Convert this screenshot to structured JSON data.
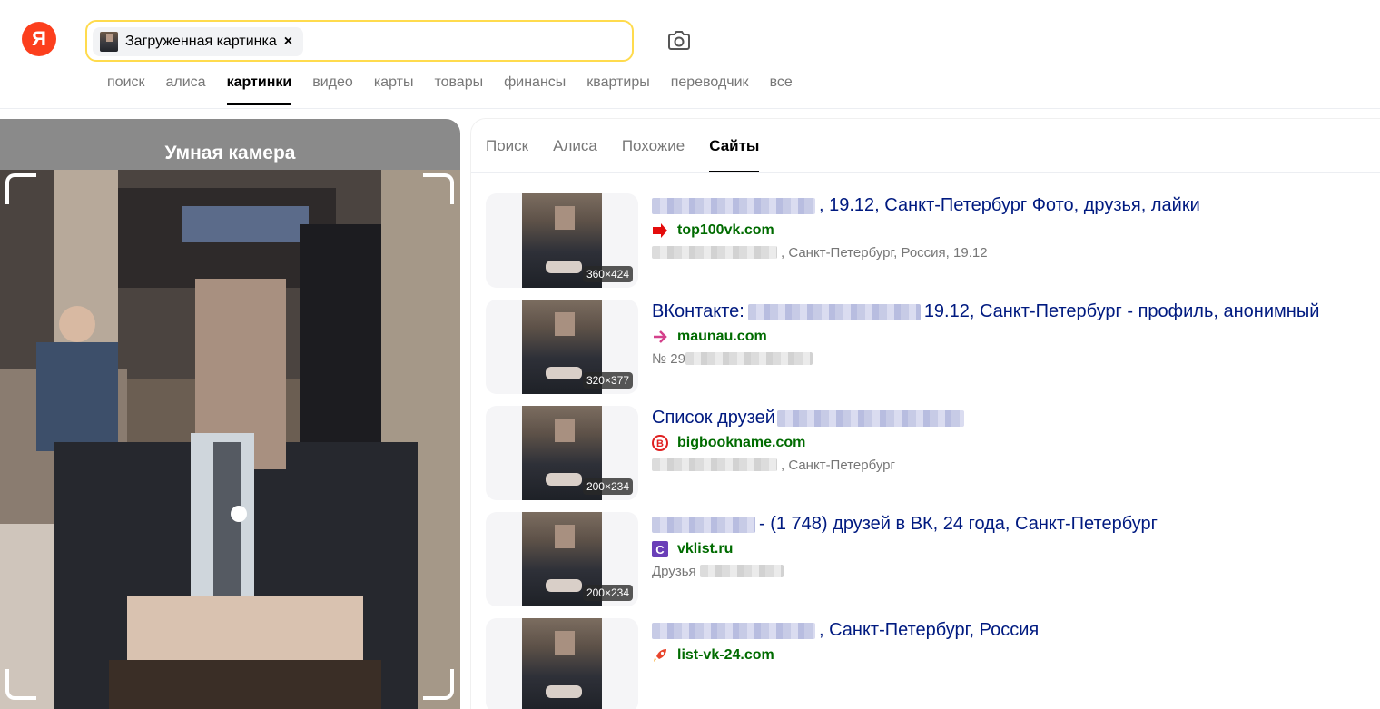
{
  "header": {
    "logo": "Я",
    "search": {
      "chip_label": "Загруженная картинка",
      "chip_close": "×"
    },
    "nav": [
      "поиск",
      "алиса",
      "картинки",
      "видео",
      "карты",
      "товары",
      "финансы",
      "квартиры",
      "переводчик",
      "все"
    ],
    "nav_active": "картинки"
  },
  "camera": {
    "title": "Умная камера"
  },
  "results": {
    "tabs": [
      "Поиск",
      "Алиса",
      "Похожие",
      "Сайты"
    ],
    "tab_active": "Сайты",
    "items": [
      {
        "title": ", 19.12, Санкт-Петербург Фото, друзья, лайки",
        "site": "top100vk.com",
        "snippet": ", Санкт-Петербург, Россия, 19.12",
        "size": "360×424",
        "favicon": "red-arrow-icon"
      },
      {
        "title_prefix": "ВКонтакте: ",
        "title": " 19.12, Санкт-Петербург - профиль, анонимный",
        "site": "maunau.com",
        "snippet": "№ 29",
        "size": "320×377",
        "favicon": "pink-arrow-icon"
      },
      {
        "title_prefix": "Список друзей",
        "title": "",
        "site": "bigbookname.com",
        "snippet": ", Санкт-Петербург",
        "size": "200×234",
        "favicon": "red-circle-b-icon"
      },
      {
        "title": " - (1 748) друзей в ВК, 24 года, Санкт-Петербург",
        "site": "vklist.ru",
        "snippet": "Друзья",
        "size": "200×234",
        "favicon": "purple-c-icon"
      },
      {
        "title": ", Санкт-Петербург, Россия",
        "site": "list-vk-24.com",
        "snippet": "",
        "size": "",
        "favicon": "rocket-icon"
      }
    ]
  },
  "colors": {
    "accent": "#ffdb4d",
    "brand": "#fc3f1d",
    "link": "#001a80",
    "site": "#006b00"
  }
}
